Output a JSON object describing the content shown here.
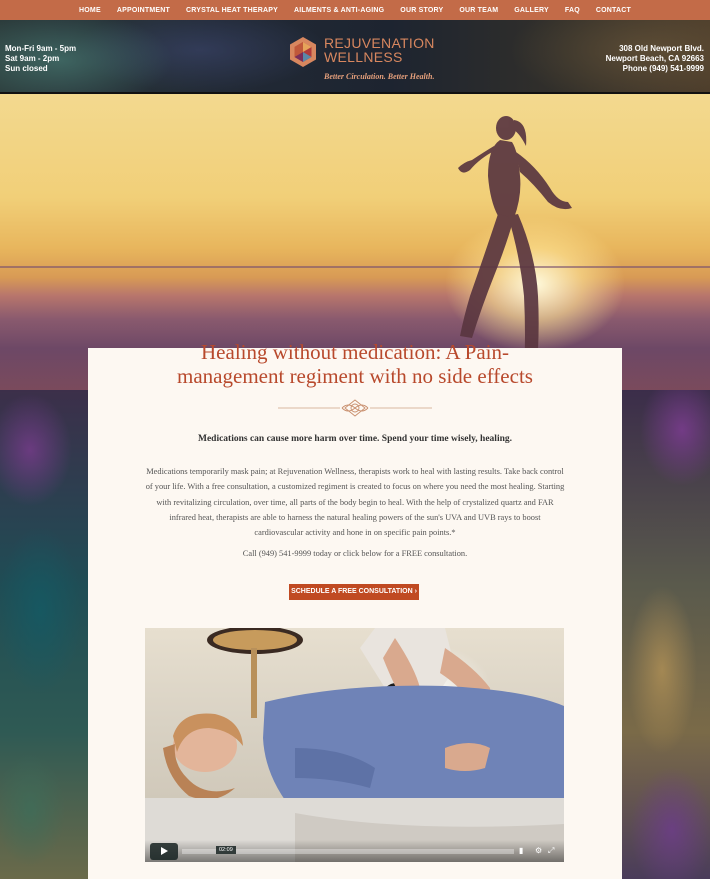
{
  "nav": {
    "items": [
      {
        "label": "HOME"
      },
      {
        "label": "APPOINTMENT"
      },
      {
        "label": "CRYSTAL HEAT THERAPY"
      },
      {
        "label": "AILMENTS & ANTI-AGING"
      },
      {
        "label": "OUR STORY"
      },
      {
        "label": "OUR TEAM"
      },
      {
        "label": "GALLERY"
      },
      {
        "label": "FAQ"
      },
      {
        "label": "CONTACT"
      }
    ]
  },
  "header": {
    "hours": [
      "Mon-Fri 9am - 5pm",
      "Sat 9am - 2pm",
      "Sun closed"
    ],
    "address": [
      "308 Old Newport Blvd.",
      "Newport Beach, CA 92663",
      "Phone (949) 541-9999"
    ],
    "logo_line1": "REJUVENATION",
    "logo_line2": "WELLNESS",
    "tagline": "Better Circulation. Better Health."
  },
  "content": {
    "headline_line1": "Healing without medication: A Pain-",
    "headline_line2": "management regiment with no side effects",
    "lead": "Medications can cause more harm over time. Spend your time wisely, healing.",
    "body": "Medications temporarily mask pain; at Rejuvenation Wellness, therapists work to heal with lasting results. Take back control of your life. With a free consultation, a customized regiment is created to focus on where you need the most healing. Starting with revitalizing circulation, over time, all parts of the body begin to heal. With the help of crystalized quartz and FAR infrared heat, therapists are able to harness the natural healing powers of the sun's UVA and UVB rays to boost cardiovascular activity and hone in on specific pain points.*",
    "call": "Call (949) 541-9999 today or click below for a FREE consultation.",
    "cta": "SCHEDULE A FREE CONSULTATION ›"
  },
  "video": {
    "duration": "02:09"
  },
  "colors": {
    "nav_bg": "#c36b48",
    "accent": "#b8492c",
    "cta_bg": "#c04a22"
  }
}
